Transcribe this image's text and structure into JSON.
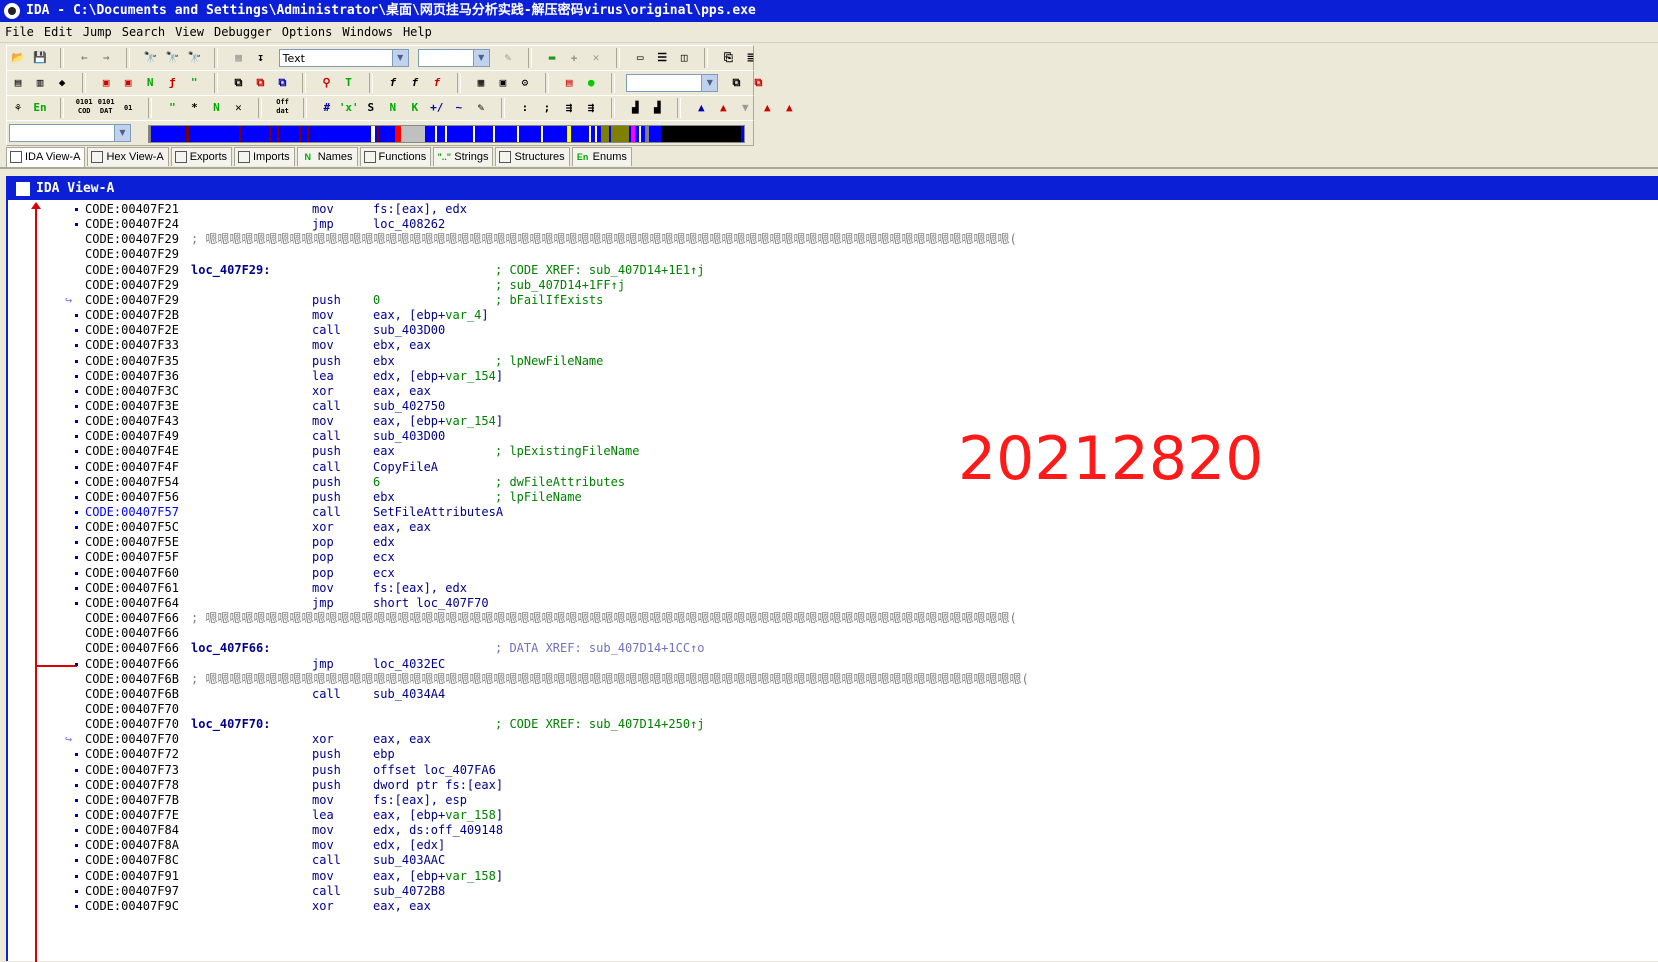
{
  "window": {
    "title": "IDA - C:\\Documents and Settings\\Administrator\\桌面\\网页挂马分析实践-解压密码virus\\original\\pps.exe"
  },
  "menu": [
    "File",
    "Edit",
    "Jump",
    "Search",
    "View",
    "Debugger",
    "Options",
    "Windows",
    "Help"
  ],
  "toolbar": {
    "mode_combo": "Text",
    "hex_glyph_1": "0101\nCOD",
    "hex_glyph_2": "0101\nDAT",
    "off_glyph": "Off\ndat",
    "en_glyph": "En"
  },
  "tabs": [
    {
      "label": "IDA View-A",
      "icon": "ida-view-icon"
    },
    {
      "label": "Hex View-A",
      "icon": "hex-view-icon"
    },
    {
      "label": "Exports",
      "icon": "exports-icon"
    },
    {
      "label": "Imports",
      "icon": "imports-icon"
    },
    {
      "label": "Names",
      "icon": "names-icon",
      "glyph": "N"
    },
    {
      "label": "Functions",
      "icon": "functions-icon"
    },
    {
      "label": "Strings",
      "icon": "strings-icon",
      "glyph": "\"..\""
    },
    {
      "label": "Structures",
      "icon": "structures-icon"
    },
    {
      "label": "Enums",
      "icon": "enums-icon",
      "glyph": "En"
    }
  ],
  "view": {
    "title": "IDA View-A"
  },
  "code": [
    {
      "addr": "CODE:00407F21",
      "mn": "mov",
      "op": "fs:[eax], edx",
      "dot": true
    },
    {
      "addr": "CODE:00407F24",
      "mn": "jmp",
      "op": "loc_408262",
      "dot": true
    },
    {
      "addr": "CODE:00407F29",
      "junk": "; 嗯嗯嗯嗯嗯嗯嗯嗯嗯嗯嗯嗯嗯嗯嗯嗯嗯嗯嗯嗯嗯嗯嗯嗯嗯嗯嗯嗯嗯嗯嗯嗯嗯嗯嗯嗯嗯嗯嗯嗯嗯嗯嗯嗯嗯嗯嗯嗯嗯嗯嗯嗯嗯嗯嗯嗯嗯嗯嗯嗯嗯嗯嗯嗯嗯嗯嗯("
    },
    {
      "addr": "CODE:00407F29"
    },
    {
      "addr": "CODE:00407F29",
      "label": "loc_407F29:",
      "comment": "; CODE XREF: sub_407D14+1E1↑j"
    },
    {
      "addr": "CODE:00407F29",
      "comment": "; sub_407D14+1FF↑j"
    },
    {
      "addr": "CODE:00407F29",
      "mn": "push",
      "op": "0",
      "opv": true,
      "comment": "; bFailIfExists",
      "arrow": true
    },
    {
      "addr": "CODE:00407F2B",
      "mn": "mov",
      "op": "eax, [ebp+",
      "opvar": "var_4",
      "opend": "]",
      "dot": true
    },
    {
      "addr": "CODE:00407F2E",
      "mn": "call",
      "op": "sub_403D00",
      "dot": true
    },
    {
      "addr": "CODE:00407F33",
      "mn": "mov",
      "op": "ebx, eax",
      "dot": true
    },
    {
      "addr": "CODE:00407F35",
      "mn": "push",
      "op": "ebx",
      "comment": "; lpNewFileName",
      "dot": true
    },
    {
      "addr": "CODE:00407F36",
      "mn": "lea",
      "op": "edx, [ebp+",
      "opvar": "var_154",
      "opend": "]",
      "dot": true
    },
    {
      "addr": "CODE:00407F3C",
      "mn": "xor",
      "op": "eax, eax",
      "dot": true
    },
    {
      "addr": "CODE:00407F3E",
      "mn": "call",
      "op": "sub_402750",
      "dot": true
    },
    {
      "addr": "CODE:00407F43",
      "mn": "mov",
      "op": "eax, [ebp+",
      "opvar": "var_154",
      "opend": "]",
      "dot": true
    },
    {
      "addr": "CODE:00407F49",
      "mn": "call",
      "op": "sub_403D00",
      "dot": true
    },
    {
      "addr": "CODE:00407F4E",
      "mn": "push",
      "op": "eax",
      "comment": "; lpExistingFileName",
      "dot": true
    },
    {
      "addr": "CODE:00407F4F",
      "mn": "call",
      "op": "CopyFileA",
      "dot": true
    },
    {
      "addr": "CODE:00407F54",
      "mn": "push",
      "op": "6",
      "opv": true,
      "comment": "; dwFileAttributes",
      "dot": true
    },
    {
      "addr": "CODE:00407F56",
      "mn": "push",
      "op": "ebx",
      "comment": "; lpFileName",
      "dot": true
    },
    {
      "addr": "CODE:00407F57",
      "mn": "call",
      "op": "SetFileAttributesA",
      "dot": true,
      "hl": true
    },
    {
      "addr": "CODE:00407F5C",
      "mn": "xor",
      "op": "eax, eax",
      "dot": true
    },
    {
      "addr": "CODE:00407F5E",
      "mn": "pop",
      "op": "edx",
      "dot": true
    },
    {
      "addr": "CODE:00407F5F",
      "mn": "pop",
      "op": "ecx",
      "dot": true
    },
    {
      "addr": "CODE:00407F60",
      "mn": "pop",
      "op": "ecx",
      "dot": true
    },
    {
      "addr": "CODE:00407F61",
      "mn": "mov",
      "op": "fs:[eax], edx",
      "dot": true
    },
    {
      "addr": "CODE:00407F64",
      "mn": "jmp",
      "op": "short loc_407F70",
      "dot": true
    },
    {
      "addr": "CODE:00407F66",
      "junk": "; 嗯嗯嗯嗯嗯嗯嗯嗯嗯嗯嗯嗯嗯嗯嗯嗯嗯嗯嗯嗯嗯嗯嗯嗯嗯嗯嗯嗯嗯嗯嗯嗯嗯嗯嗯嗯嗯嗯嗯嗯嗯嗯嗯嗯嗯嗯嗯嗯嗯嗯嗯嗯嗯嗯嗯嗯嗯嗯嗯嗯嗯嗯嗯嗯嗯嗯嗯("
    },
    {
      "addr": "CODE:00407F66"
    },
    {
      "addr": "CODE:00407F66",
      "label": "loc_407F66:",
      "comment": "; DATA XREF: sub_407D14+1CC↑o",
      "cmgray": true
    },
    {
      "addr": "CODE:00407F66",
      "mn": "jmp",
      "op": "loc_4032EC",
      "dot": true
    },
    {
      "addr": "CODE:00407F6B",
      "junk": "; 嗯嗯嗯嗯嗯嗯嗯嗯嗯嗯嗯嗯嗯嗯嗯嗯嗯嗯嗯嗯嗯嗯嗯嗯嗯嗯嗯嗯嗯嗯嗯嗯嗯嗯嗯嗯嗯嗯嗯嗯嗯嗯嗯嗯嗯嗯嗯嗯嗯嗯嗯嗯嗯嗯嗯嗯嗯嗯嗯嗯嗯嗯嗯嗯嗯嗯嗯嗯("
    },
    {
      "addr": "CODE:00407F6B",
      "mn": "call",
      "op": "sub_4034A4"
    },
    {
      "addr": "CODE:00407F70"
    },
    {
      "addr": "CODE:00407F70",
      "label": "loc_407F70:",
      "comment": "; CODE XREF: sub_407D14+250↑j"
    },
    {
      "addr": "CODE:00407F70",
      "mn": "xor",
      "op": "eax, eax",
      "arrow": true
    },
    {
      "addr": "CODE:00407F72",
      "mn": "push",
      "op": "ebp",
      "dot": true
    },
    {
      "addr": "CODE:00407F73",
      "mn": "push",
      "op": "offset loc_407FA6",
      "dot": true
    },
    {
      "addr": "CODE:00407F78",
      "mn": "push",
      "op": "dword ptr fs:[eax]",
      "dot": true
    },
    {
      "addr": "CODE:00407F7B",
      "mn": "mov",
      "op": "fs:[eax], esp",
      "dot": true
    },
    {
      "addr": "CODE:00407F7E",
      "mn": "lea",
      "op": "eax, [ebp+",
      "opvar": "var_158",
      "opend": "]",
      "dot": true
    },
    {
      "addr": "CODE:00407F84",
      "mn": "mov",
      "op": "edx, ds:off_409148",
      "dot": true
    },
    {
      "addr": "CODE:00407F8A",
      "mn": "mov",
      "op": "edx, [edx]",
      "dot": true
    },
    {
      "addr": "CODE:00407F8C",
      "mn": "call",
      "op": "sub_403AAC",
      "dot": true
    },
    {
      "addr": "CODE:00407F91",
      "mn": "mov",
      "op": "eax, [ebp+",
      "opvar": "var_158",
      "opend": "]",
      "dot": true
    },
    {
      "addr": "CODE:00407F97",
      "mn": "call",
      "op": "sub_4072B8",
      "dot": true
    },
    {
      "addr": "CODE:00407F9C",
      "mn": "xor",
      "op": "eax, eax",
      "dot": true
    }
  ],
  "overlay": {
    "text": "20212820",
    "color": "#ff1a1a"
  },
  "colors": {
    "title_bar": "#0a1fd6",
    "code_text": "#00008b",
    "comment": "#008000",
    "flow_arrow": "#dd0000"
  }
}
